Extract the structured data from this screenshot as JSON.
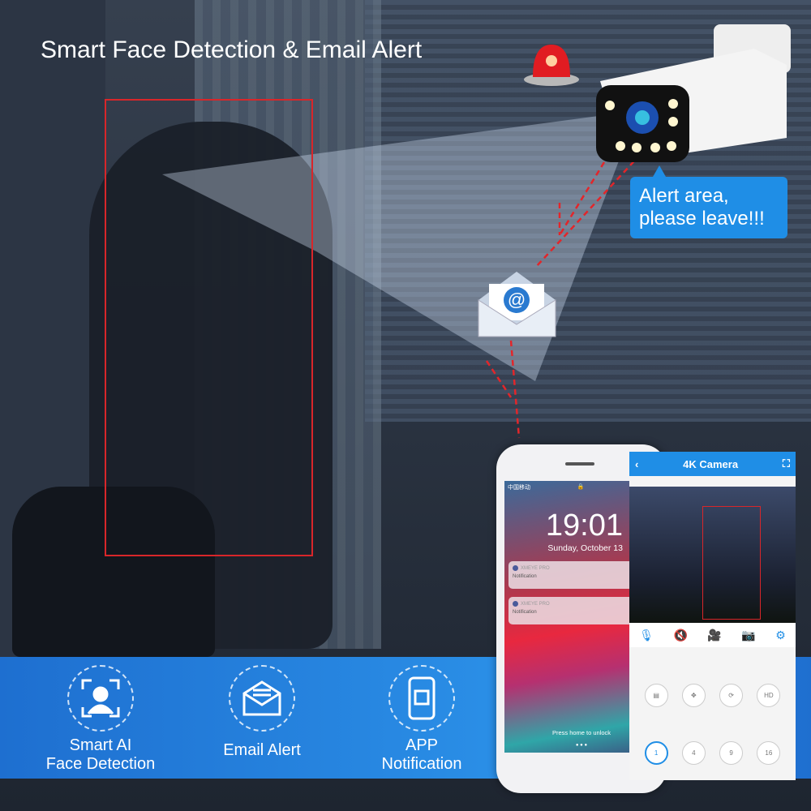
{
  "headline": "Smart Face Detection & Email Alert",
  "speech_bubble": {
    "line1": "Alert area,",
    "line2": "please leave!!!"
  },
  "features": [
    {
      "icon": "face-scan-icon",
      "line1": "Smart AI",
      "line2": "Face Detection"
    },
    {
      "icon": "email-icon",
      "line1": "Email Alert",
      "line2": ""
    },
    {
      "icon": "phone-app-icon",
      "line1": "APP",
      "line2": "Notification"
    }
  ],
  "lock_screen": {
    "carrier": "中国移动",
    "time": "19:01",
    "date": "Sunday, October 13",
    "notifications": [
      {
        "app": "XMEYE PRO",
        "text": "Notification"
      },
      {
        "app": "XMEYE PRO",
        "text": "Notification"
      }
    ],
    "unlock_hint": "Press home to unlock"
  },
  "camera_app": {
    "title": "4K Camera",
    "toolbar": [
      "microphone-icon",
      "mute-icon",
      "record-icon",
      "snapshot-icon",
      "settings-icon"
    ],
    "controls": [
      "playback-icon",
      "ptz-icon",
      "tour-icon",
      "hd-icon"
    ],
    "split_options": [
      "1",
      "4",
      "9",
      "16"
    ],
    "selected_split": "1"
  },
  "colors": {
    "accent": "#1f8ee6",
    "detect_box": "#d8262a"
  }
}
